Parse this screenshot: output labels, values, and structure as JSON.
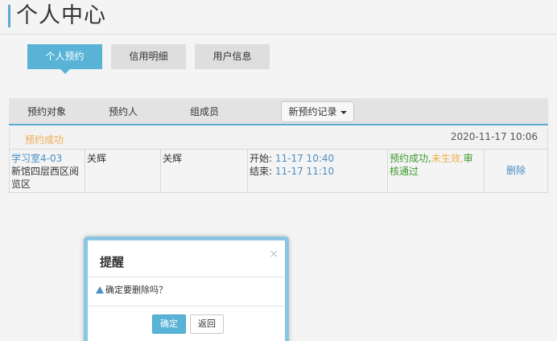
{
  "header": {
    "title": "个人中心"
  },
  "tabs": [
    {
      "label": "个人预约",
      "active": true
    },
    {
      "label": "信用明细",
      "active": false
    },
    {
      "label": "用户信息",
      "active": false
    }
  ],
  "table": {
    "headers": [
      "预约对象",
      "预约人",
      "组成员"
    ],
    "dropdown_label": "新预约记录",
    "group": {
      "status": "预约成功",
      "time": "2020-11-17 10:06"
    },
    "row": {
      "room": "学习室4-03",
      "location": "新馆四层西区阅览区",
      "booker": "关辉",
      "members": "关辉",
      "start_label": "开始:",
      "start_time": "11-17 10:40",
      "end_label": "结束:",
      "end_time": "11-17 11:10",
      "status_success": "预约成功,",
      "status_pending": "未生效,",
      "status_review": "审核通过",
      "action": "删除"
    }
  },
  "modal": {
    "title": "提醒",
    "close_symbol": "×",
    "message": "确定要删除吗？",
    "ok_label": "确定",
    "back_label": "返回"
  },
  "colors": {
    "accent": "#58b3d6",
    "link": "#4a8ec2",
    "success": "#3c9a2a",
    "warning": "#f0ad4e"
  }
}
